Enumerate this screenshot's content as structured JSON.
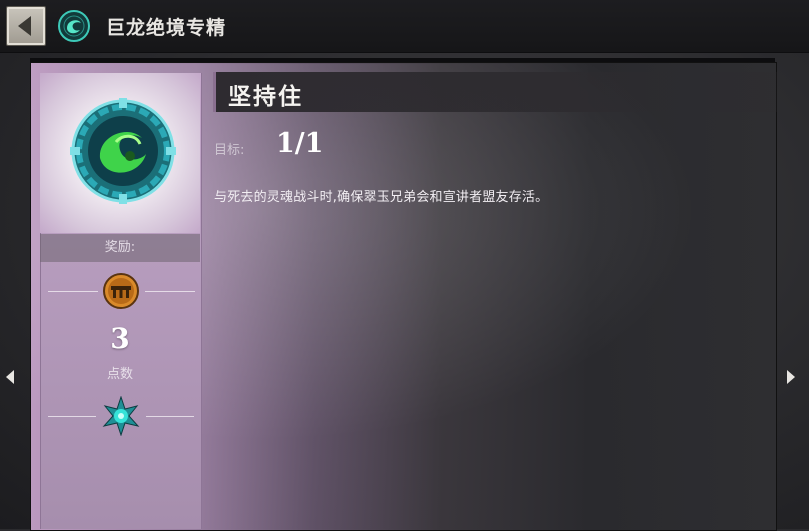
{
  "window": {
    "title": "巨龙绝境专精",
    "back_icon": "back-arrow-icon",
    "emblem_icon": "mastery-emblem-icon"
  },
  "achievement": {
    "title": "坚持住",
    "objective_label": "目标:",
    "objective_value": "1/1",
    "description": "与死去的灵魂战斗时,确保翠玉兄弟会和宣讲者盟友存活。",
    "badge_icon": "jade-dragon-badge-icon"
  },
  "reward": {
    "label": "奖励:",
    "icon": "mastery-point-icon",
    "points_value": "3",
    "points_label": "点数",
    "tier_icon": "spiked-star-icon"
  },
  "nav": {
    "prev_icon": "chevron-left-icon",
    "next_icon": "chevron-right-icon"
  },
  "colors": {
    "panel_lilac": "#c6a8cc",
    "badge_green": "#39c84a",
    "badge_teal": "#2aa0b0",
    "reward_orange": "#d98a2a",
    "star_teal": "#24c7c0"
  }
}
